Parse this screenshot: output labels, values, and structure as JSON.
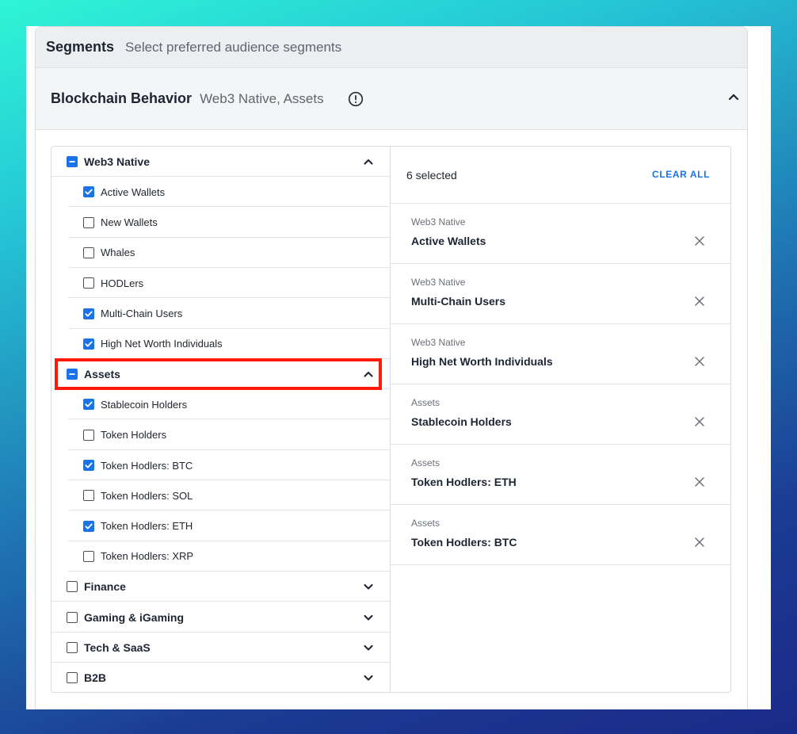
{
  "header": {
    "title": "Segments",
    "subtitle": "Select preferred audience segments"
  },
  "section": {
    "title": "Blockchain Behavior",
    "subtitle": "Web3 Native, Assets",
    "info_icon": "info-circle-icon",
    "expand_icon": "chevron-up-icon"
  },
  "tree": {
    "groups": [
      {
        "label": "Web3 Native",
        "state": "partial",
        "expanded": true,
        "items": [
          {
            "label": "Active Wallets",
            "checked": true
          },
          {
            "label": "New Wallets",
            "checked": false
          },
          {
            "label": "Whales",
            "checked": false
          },
          {
            "label": "HODLers",
            "checked": false
          },
          {
            "label": "Multi-Chain Users",
            "checked": true
          },
          {
            "label": "High Net Worth Individuals",
            "checked": true
          }
        ]
      },
      {
        "label": "Assets",
        "state": "partial",
        "expanded": true,
        "items": [
          {
            "label": "Stablecoin Holders",
            "checked": true
          },
          {
            "label": "Token Holders",
            "checked": false
          },
          {
            "label": "Token Hodlers: BTC",
            "checked": true
          },
          {
            "label": "Token Hodlers: SOL",
            "checked": false
          },
          {
            "label": "Token Hodlers: ETH",
            "checked": true
          },
          {
            "label": "Token Hodlers: XRP",
            "checked": false
          }
        ]
      },
      {
        "label": "Finance",
        "state": "off",
        "expanded": false,
        "items": []
      },
      {
        "label": "Gaming & iGaming",
        "state": "off",
        "expanded": false,
        "items": []
      },
      {
        "label": "Tech & SaaS",
        "state": "off",
        "expanded": false,
        "items": []
      },
      {
        "label": "B2B",
        "state": "off",
        "expanded": false,
        "items": []
      }
    ]
  },
  "selected": {
    "count_label": "6 selected",
    "clear_label": "CLEAR ALL",
    "items": [
      {
        "category": "Web3 Native",
        "name": "Active Wallets"
      },
      {
        "category": "Web3 Native",
        "name": "Multi-Chain Users"
      },
      {
        "category": "Web3 Native",
        "name": "High Net Worth Individuals"
      },
      {
        "category": "Assets",
        "name": "Stablecoin Holders"
      },
      {
        "category": "Assets",
        "name": "Token Hodlers: ETH"
      },
      {
        "category": "Assets",
        "name": "Token Hodlers: BTC"
      }
    ]
  },
  "colors": {
    "accent": "#1a73e8",
    "highlight": "#ff1a0a"
  }
}
